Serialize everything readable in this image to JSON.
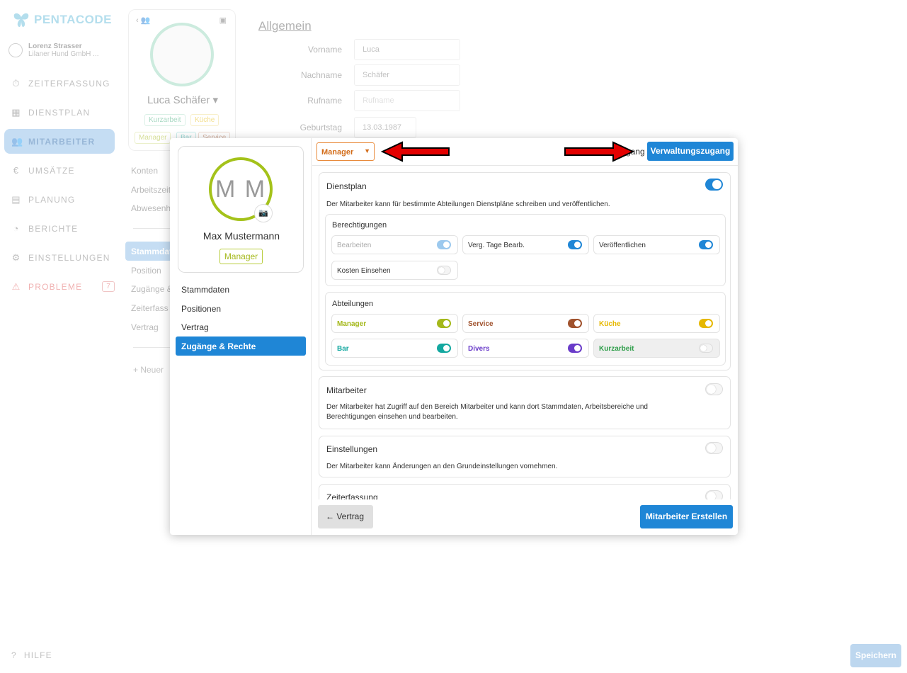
{
  "brand": {
    "name": "PENTACODE",
    "accent": "#5ab8d8"
  },
  "user": {
    "name": "Lorenz Strasser",
    "company": "Lilaner Hund GmbH ..."
  },
  "nav": [
    {
      "label": "ZEITERFASSUNG",
      "icon": "stopwatch-icon"
    },
    {
      "label": "DIENSTPLAN",
      "icon": "table-icon"
    },
    {
      "label": "MITARBEITER",
      "icon": "users-icon"
    },
    {
      "label": "UMSÄTZE",
      "icon": "euro-icon"
    },
    {
      "label": "PLANUNG",
      "icon": "calendar-icon"
    },
    {
      "label": "BERICHTE",
      "icon": "pie-chart-icon"
    },
    {
      "label": "EINSTELLUNGEN",
      "icon": "gear-icon"
    },
    {
      "label": "PROBLEME",
      "icon": "warning-icon",
      "badge": "7"
    }
  ],
  "help": "HILFE",
  "background_profile": {
    "name": "Luca Schäfer",
    "tags": [
      "Kurzarbeit",
      "Küche",
      "Manager",
      "Bar",
      "Service"
    ],
    "subnav_a": [
      "Konten",
      "Arbeitszeit",
      "Abwesenh"
    ],
    "subnav_active": "Stammdat",
    "subnav_b": [
      "Position",
      "Zugänge &",
      "Zeiterfass",
      "Vertrag"
    ],
    "neuer": "+ Neuer"
  },
  "form": {
    "section_title": "Allgemein",
    "fields": [
      {
        "label": "Vorname",
        "value": "Luca"
      },
      {
        "label": "Nachname",
        "value": "Schäfer"
      },
      {
        "label": "Rufname",
        "placeholder": "Rufname"
      },
      {
        "label": "Geburtstag",
        "value": "13.03.1987"
      }
    ],
    "save_label": "Speichern"
  },
  "modal": {
    "initials": "M M",
    "name": "Max Mustermann",
    "role_tag": "Manager",
    "nav": [
      "Stammdaten",
      "Positionen",
      "Vertrag",
      "Zugänge & Rechte"
    ],
    "role_select": "Manager",
    "zugang_partial": "gang",
    "vz_button": "Verwaltungszugang",
    "dienstplan": {
      "title": "Dienstplan",
      "desc": "Der Mitarbeiter kann für bestimmte Abteilungen Dienstpläne schreiben und veröffentlichen.",
      "enabled": true,
      "berechtigungen": {
        "title": "Berechtigungen",
        "items": [
          {
            "label": "Bearbeiten",
            "state": "on-disabled"
          },
          {
            "label": "Verg. Tage Bearb.",
            "state": "on"
          },
          {
            "label": "Veröffentlichen",
            "state": "on"
          },
          {
            "label": "Kosten Einsehen",
            "state": "off"
          }
        ]
      },
      "abteilungen": {
        "title": "Abteilungen",
        "items": [
          {
            "label": "Manager",
            "color": "#a4b81a",
            "on": true
          },
          {
            "label": "Service",
            "color": "#a0522d",
            "on": true
          },
          {
            "label": "Küche",
            "color": "#e6b800",
            "on": true
          },
          {
            "label": "Bar",
            "color": "#14a8a0",
            "on": true
          },
          {
            "label": "Divers",
            "color": "#6a3cc9",
            "on": true
          },
          {
            "label": "Kurzarbeit",
            "color": "#2e9e4a",
            "on": false
          }
        ]
      }
    },
    "mitarbeiter": {
      "title": "Mitarbeiter",
      "desc": "Der Mitarbeiter hat Zugriff auf den Bereich Mitarbeiter und kann dort Stammdaten, Arbeitsbereiche und Berechtigungen einsehen und bearbeiten.",
      "enabled": false
    },
    "einstellungen": {
      "title": "Einstellungen",
      "desc": "Der Mitarbeiter kann Änderungen an den Grundeinstellungen vornehmen.",
      "enabled": false
    },
    "zeiterfassung": {
      "title": "Zeiterfassung",
      "enabled": false
    },
    "back_label": "Vertrag",
    "create_label": "Mitarbeiter Erstellen"
  }
}
